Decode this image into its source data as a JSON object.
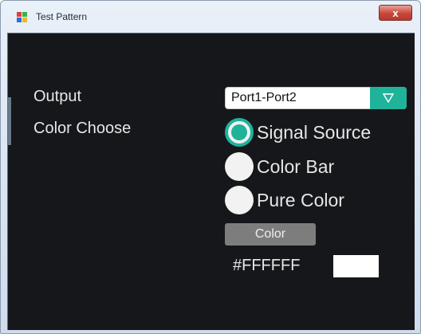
{
  "window": {
    "title": "Test Pattern",
    "close_label": "x"
  },
  "form": {
    "output_label": "Output",
    "output_value": "Port1-Port2",
    "color_choose_label": "Color Choose",
    "options": [
      {
        "label": "Signal Source",
        "checked": true
      },
      {
        "label": "Color Bar",
        "checked": false
      },
      {
        "label": "Pure Color",
        "checked": false
      }
    ],
    "color_button_label": "Color",
    "color_hex": "#FFFFFF",
    "swatch_color": "#FFFFFF"
  },
  "colors": {
    "accent": "#1fb39a",
    "background": "#15171b"
  },
  "icons": {
    "app": "app-icon",
    "dropdown": "triangle-down-icon",
    "close": "close-icon"
  }
}
